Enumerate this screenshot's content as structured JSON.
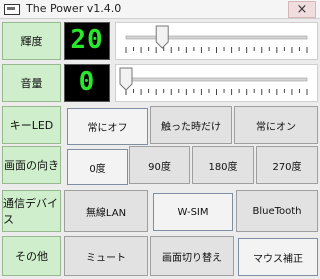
{
  "window": {
    "title": "The Power v1.4.0",
    "close_glyph": "×"
  },
  "rows": {
    "brightness": {
      "label": "輝度",
      "display": "20",
      "level": 0.2,
      "tick_count": 24
    },
    "volume": {
      "label": "音量",
      "display": "0",
      "level": 0.0,
      "tick_count": 24
    },
    "key_led": {
      "label": "キーLED",
      "options": [
        "常にオフ",
        "触った時だけ",
        "常にオン"
      ],
      "selected": 0
    },
    "orientation": {
      "label": "画面の向き",
      "options": [
        "0度",
        "90度",
        "180度",
        "270度"
      ],
      "selected": 0
    },
    "comm": {
      "label": "通信デバイス",
      "options": [
        "無線LAN",
        "W-SIM",
        "BlueTooth"
      ],
      "selected": 1
    },
    "other": {
      "label": "その他",
      "buttons": [
        "ミュート",
        "画面切り替え",
        "マウス補正"
      ],
      "active": 2
    }
  },
  "colors": {
    "label_bg": "#cfeecb",
    "segment_fg": "#29e82a",
    "segment_bg": "#000000",
    "button_bg": "#e2e2e2",
    "selected_border": "#7f8ea3"
  }
}
